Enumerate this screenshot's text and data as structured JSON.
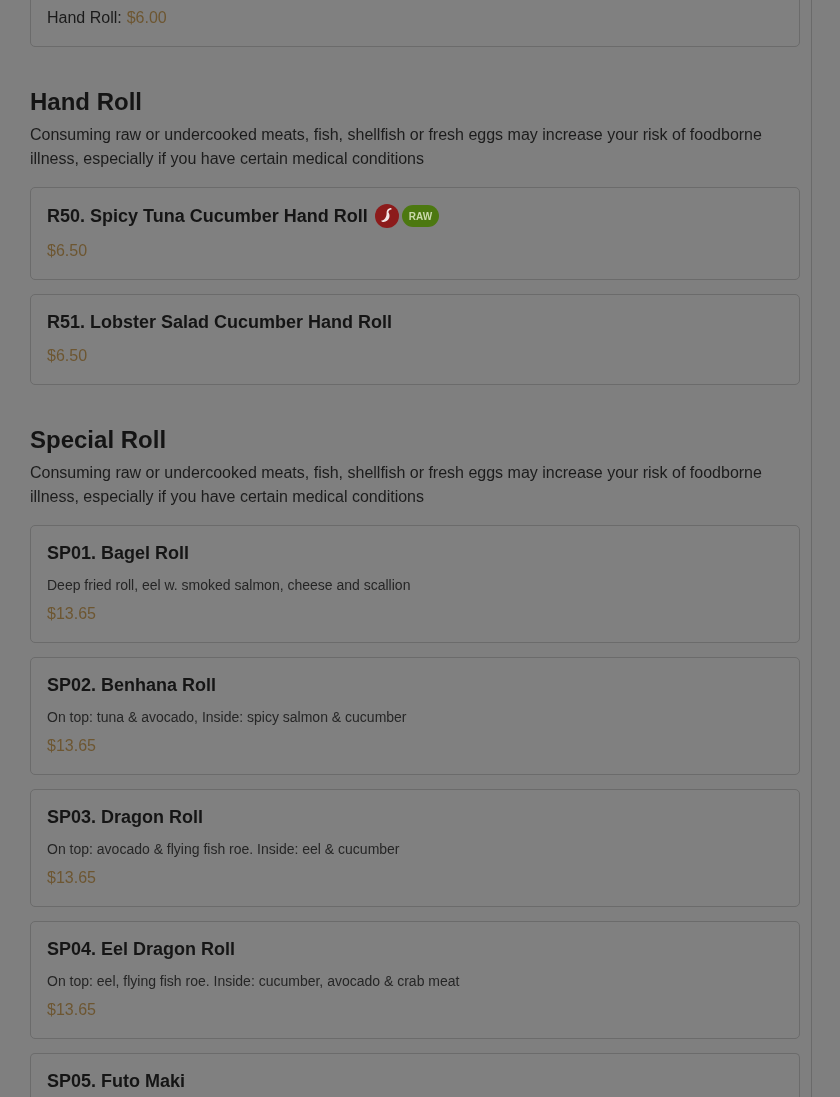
{
  "partial_item": {
    "options": [
      {
        "label": "Hand Roll:",
        "price": "$6.00"
      }
    ]
  },
  "sections": [
    {
      "title": "Hand Roll",
      "notice": "Consuming raw or undercooked meats, fish, shellfish or fresh eggs may increase your risk of foodborne illness, especially if you have certain medical conditions",
      "items": [
        {
          "name": "R50. Spicy Tuna Cucumber Hand Roll",
          "spicy": true,
          "badges": [
            "RAW"
          ],
          "price": "$6.50"
        },
        {
          "name": "R51. Lobster Salad Cucumber Hand Roll",
          "spicy": false,
          "price": "$6.50"
        }
      ]
    },
    {
      "title": "Special Roll",
      "notice": "Consuming raw or undercooked meats, fish, shellfish or fresh eggs may increase your risk of foodborne illness, especially if you have certain medical conditions",
      "items": [
        {
          "name": "SP01. Bagel Roll",
          "spicy": false,
          "description": "Deep fried roll, eel w. smoked salmon, cheese and scallion",
          "price": "$13.65"
        },
        {
          "name": "SP02. Benhana Roll",
          "spicy": false,
          "description": "On top: tuna & avocado, Inside: spicy salmon & cucumber",
          "price": "$13.65"
        },
        {
          "name": "SP03. Dragon Roll",
          "spicy": false,
          "description": "On top: avocado & flying fish roe. Inside: eel & cucumber",
          "price": "$13.65"
        },
        {
          "name": "SP04. Eel Dragon Roll",
          "spicy": false,
          "description": "On top: eel, flying fish roe. Inside: cucumber, avocado & crab meat",
          "price": "$13.65"
        },
        {
          "name": "SP05. Futo Maki",
          "spicy": false
        }
      ]
    }
  ]
}
